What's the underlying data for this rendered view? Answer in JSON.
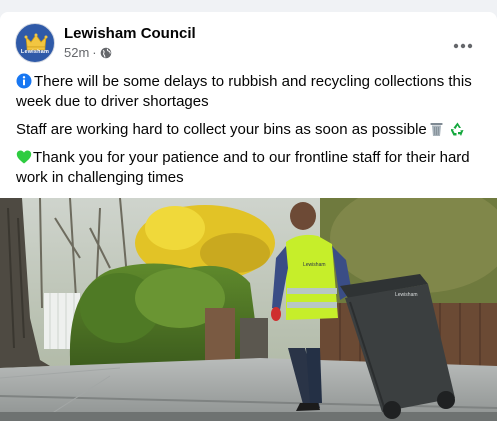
{
  "post": {
    "author": "Lewisham Council",
    "avatar_text": "Lewisham",
    "timestamp": "52m",
    "separator": "·",
    "audience_icon": "globe-icon",
    "more_icon": "more-options-icon",
    "paragraphs": [
      {
        "emoji_icon": "info-icon",
        "text": "There will be some delays to rubbish and recycling collections this week due to driver shortages"
      },
      {
        "emoji_icon": "",
        "text": "Staff are working hard to collect your bins as soon as possible"
      },
      {
        "emoji_icon": "green-heart-icon",
        "text": "Thank you for your patience and to our frontline staff for their hard work in challenging times"
      }
    ],
    "trailing_icons": [
      "wastebasket-icon",
      "recycling-icon"
    ],
    "bin_lid_text": "Lewisham",
    "vest_text": "Lewisham"
  },
  "colors": {
    "info": "#1877f2",
    "heart": "#2ecc40",
    "recycle": "#14a83d",
    "vest": "#c6ee2a",
    "bin": "#3b3f40"
  }
}
